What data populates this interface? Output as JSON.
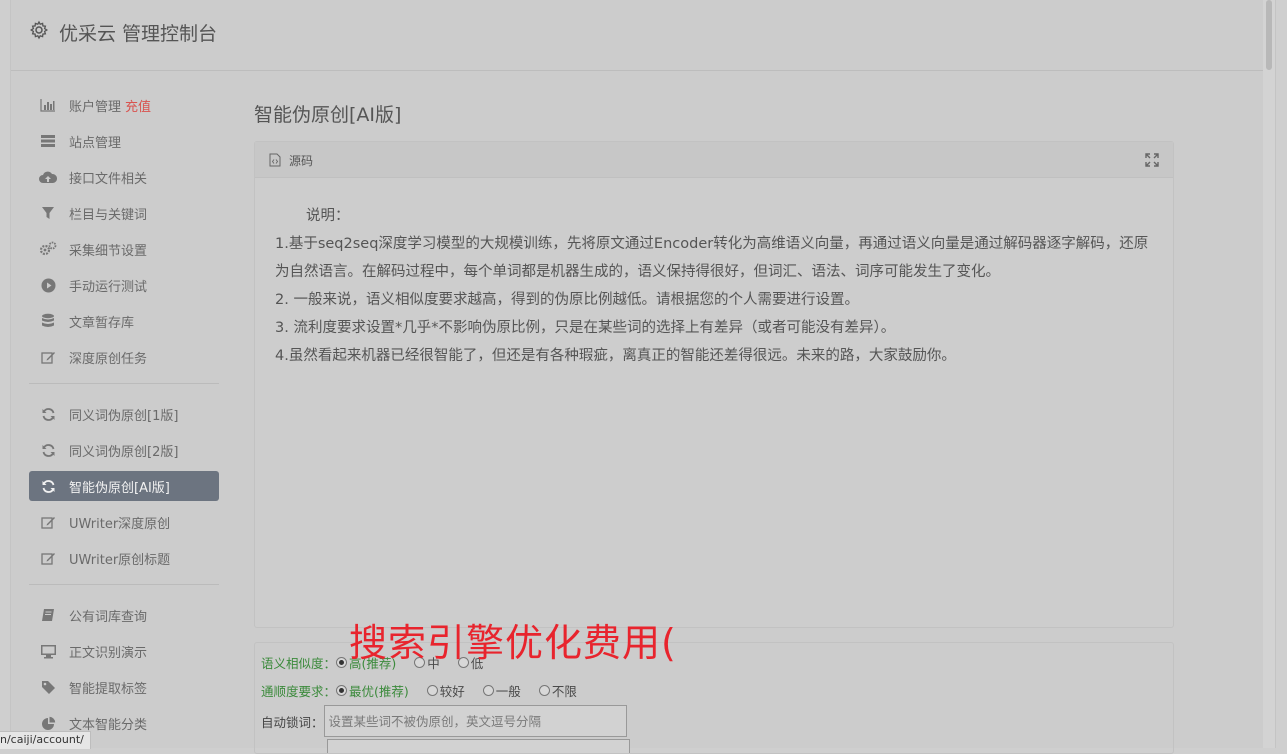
{
  "app": {
    "title": "优采云 管理控制台"
  },
  "sidebar": {
    "groups": [
      [
        {
          "label": "账户管理",
          "badge": "充值",
          "icon": "bar-chart-icon"
        },
        {
          "label": "站点管理",
          "icon": "server-icon"
        },
        {
          "label": "接口文件相关",
          "icon": "cloud-upload-icon"
        },
        {
          "label": "栏目与关键词",
          "icon": "filter-icon"
        },
        {
          "label": "采集细节设置",
          "icon": "gears-icon"
        },
        {
          "label": "手动运行测试",
          "icon": "play-circle-icon"
        },
        {
          "label": "文章暂存库",
          "icon": "database-icon"
        },
        {
          "label": "深度原创任务",
          "icon": "edit-icon"
        }
      ],
      [
        {
          "label": "同义词伪原创[1版]",
          "icon": "refresh-icon"
        },
        {
          "label": "同义词伪原创[2版]",
          "icon": "refresh-icon"
        },
        {
          "label": "智能伪原创[AI版]",
          "icon": "refresh-icon",
          "active": true
        },
        {
          "label": "UWriter深度原创",
          "icon": "edit-icon"
        },
        {
          "label": "UWriter原创标题",
          "icon": "edit-icon"
        }
      ],
      [
        {
          "label": "公有词库查询",
          "icon": "book-icon"
        },
        {
          "label": "正文识别演示",
          "icon": "desktop-icon"
        },
        {
          "label": "智能提取标签",
          "icon": "tag-icon"
        },
        {
          "label": "文本智能分类",
          "icon": "pie-chart-icon"
        }
      ]
    ]
  },
  "main": {
    "page_title": "智能伪原创[AI版]",
    "panel": {
      "source_label": "源码",
      "note_title": "说明：",
      "lines": [
        "1.基于seq2seq深度学习模型的大规模训练，先将原文通过Encoder转化为高维语义向量，再通过语义向量是通过解码器逐字解码，还原为自然语言。在解码过程中，每个单词都是机器生成的，语义保持得很好，但词汇、语法、词序可能发生了变化。",
        "2. 一般来说，语义相似度要求越高，得到的伪原比例越低。请根据您的个人需要进行设置。",
        "3. 流利度要求设置*几乎*不影响伪原比例，只是在某些词的选择上有差异（或者可能没有差异）。",
        "4.虽然看起来机器已经很智能了，但还是有各种瑕疵，离真正的智能还差得很远。未来的路，大家鼓励你。"
      ]
    },
    "form": {
      "similarity": {
        "label": "语义相似度：",
        "options": [
          "高(推荐)",
          "中",
          "低"
        ],
        "selected": 0
      },
      "fluency": {
        "label": "通顺度要求：",
        "options": [
          "最优(推荐)",
          "较好",
          "一般",
          "不限"
        ],
        "selected": 0
      },
      "lock_words": {
        "label": "自动锁词：",
        "placeholder": "设置某些词不被伪原创，英文逗号分隔"
      }
    }
  },
  "overlay": {
    "watermark": "搜索引擎优化费用("
  },
  "statusbar": {
    "url": "n/caiji/account/"
  },
  "colors": {
    "active_bg": "#6c7480",
    "accent_red": "#d9534f",
    "label_green": "#3b8a3b",
    "watermark_red": "#e8242d"
  }
}
